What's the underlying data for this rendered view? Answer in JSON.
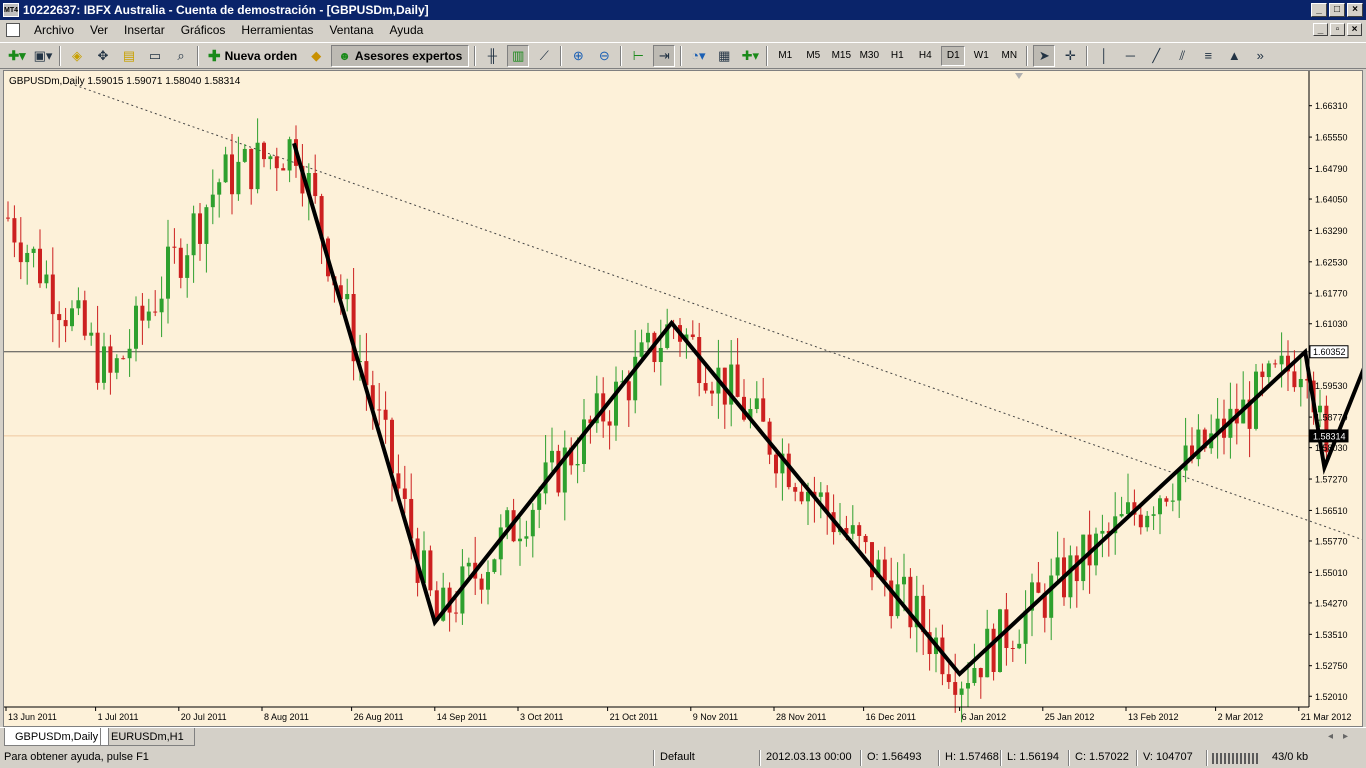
{
  "window": {
    "title": "10222637: IBFX Australia - Cuenta de demostración - [GBPUSDm,Daily]",
    "app_icon_text": "MT4"
  },
  "menu": [
    "Archivo",
    "Ver",
    "Insertar",
    "Gráficos",
    "Herramientas",
    "Ventana",
    "Ayuda"
  ],
  "toolbar": {
    "new_order_label": "Nueva orden",
    "experts_label": "Asesores expertos",
    "timeframes": [
      "M1",
      "M5",
      "M15",
      "M30",
      "H1",
      "H4",
      "D1",
      "W1",
      "MN"
    ],
    "active_timeframe": "D1"
  },
  "chart": {
    "header": "GBPUSDm,Daily  1.59015 1.59071 1.58040 1.58314",
    "background": "#fdf1d9",
    "bull_color": "#2ea02e",
    "bear_color": "#cc2020",
    "current_price_label": "1.60352",
    "bid_price_label": "1.58314"
  },
  "chart_data": {
    "type": "candlestick",
    "symbol": "GBPUSDm",
    "period": "Daily",
    "ohlc_last": {
      "open": 1.59015,
      "high": 1.59071,
      "low": 1.5804,
      "close": 1.58314
    },
    "ylim": [
      1.5175,
      1.6715
    ],
    "y_ticks": [
      "1.66310",
      "1.65550",
      "1.64790",
      "1.64050",
      "1.63290",
      "1.62530",
      "1.61770",
      "1.61030",
      "1.60352",
      "1.59530",
      "1.58770",
      "1.58314",
      "1.58030",
      "1.57270",
      "1.56510",
      "1.55770",
      "1.55010",
      "1.54270",
      "1.53510",
      "1.52750",
      "1.52010"
    ],
    "x_ticks": [
      "13 Jun 2011",
      "1 Jul 2011",
      "20 Jul 2011",
      "8 Aug 2011",
      "26 Aug 2011",
      "14 Sep 2011",
      "3 Oct 2011",
      "21 Oct 2011",
      "9 Nov 2011",
      "28 Nov 2011",
      "16 Dec 2011",
      "6 Jan 2012",
      "25 Jan 2012",
      "13 Feb 2012",
      "2 Mar 2012",
      "21 Mar 2012"
    ],
    "horizontal_lines": [
      {
        "price": 1.60352,
        "style": "solid",
        "color": "#4a4a4a"
      },
      {
        "price": 1.58314,
        "style": "solid",
        "color": "#f0c8a0"
      }
    ],
    "trendline": {
      "from": {
        "date": "25 Jun 2011",
        "price": 1.6685
      },
      "to": {
        "date": "3 May 2012",
        "price": 1.5465
      },
      "style": "dotted"
    },
    "zigzag": [
      {
        "date": "15 Aug 2011",
        "price": 1.654
      },
      {
        "date": "14 Sep 2011",
        "price": 1.538
      },
      {
        "date": "4 Nov 2011",
        "price": 1.6105
      },
      {
        "date": "6 Jan 2012",
        "price": 1.5255
      },
      {
        "date": "22 Mar 2012",
        "price": 1.6035
      },
      {
        "date": "27 Mar 2012",
        "price": 1.5755
      },
      {
        "date": "27 Apr 2012",
        "price": 1.665
      }
    ]
  },
  "tabs": [
    "GBPUSDm,Daily",
    "EURUSDm,H1"
  ],
  "active_tab": "GBPUSDm,Daily",
  "status": {
    "help": "Para obtener ayuda, pulse F1",
    "profile": "Default",
    "datetime": "2012.03.13 00:00",
    "open": "O: 1.56493",
    "high": "H: 1.57468",
    "low": "L: 1.56194",
    "close": "C: 1.57022",
    "volume": "V: 104707",
    "traffic": "43/0 kb"
  }
}
